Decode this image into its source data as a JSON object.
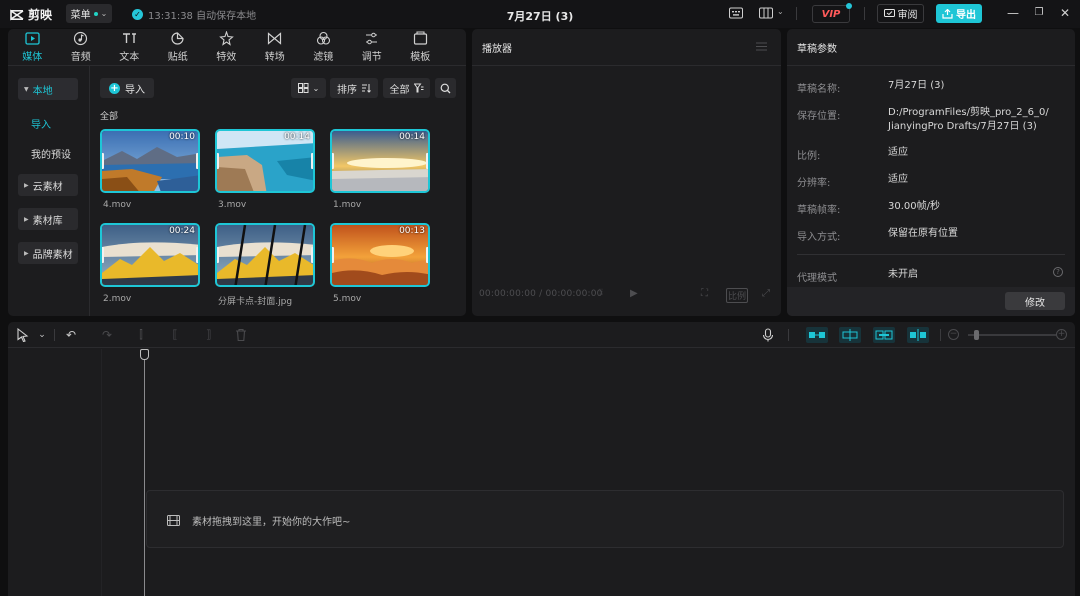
{
  "app": {
    "name": "剪映",
    "menu_label": "菜单",
    "save_status": "13:31:38 自动保存本地",
    "title": "7月27日 (3)",
    "vip_label": "VIP",
    "review_label": "审阅",
    "export_label": "导出",
    "accent_color": "#1ec6d6"
  },
  "media_tabs": [
    {
      "label": "媒体",
      "icon": "media-icon",
      "active": true
    },
    {
      "label": "音频",
      "icon": "audio-icon",
      "active": false
    },
    {
      "label": "文本",
      "icon": "text-icon",
      "active": false
    },
    {
      "label": "贴纸",
      "icon": "sticker-icon",
      "active": false
    },
    {
      "label": "特效",
      "icon": "effects-icon",
      "active": false
    },
    {
      "label": "转场",
      "icon": "transition-icon",
      "active": false
    },
    {
      "label": "滤镜",
      "icon": "filter-icon",
      "active": false
    },
    {
      "label": "调节",
      "icon": "adjust-icon",
      "active": false
    },
    {
      "label": "模板",
      "icon": "template-icon",
      "active": false
    }
  ],
  "sidebar": {
    "local": "本地",
    "import": "导入",
    "my_presets": "我的预设",
    "cloud": "云素材",
    "library": "素材库",
    "brand": "品牌素材"
  },
  "media_toolbar": {
    "import_label": "导入",
    "sort_label": "排序",
    "filter_label": "全部"
  },
  "media_section_label": "全部",
  "media_items": [
    {
      "name": "4.mov",
      "duration": "00:10"
    },
    {
      "name": "3.mov",
      "duration": "00:14"
    },
    {
      "name": "1.mov",
      "duration": "00:14"
    },
    {
      "name": "2.mov",
      "duration": "00:24"
    },
    {
      "name": "分屏卡点-封面.jpg",
      "duration": ""
    },
    {
      "name": "5.mov",
      "duration": "00:13"
    }
  ],
  "player": {
    "title": "播放器",
    "timecode_current": "00:00:00:00",
    "timecode_total": "00:00:00:00",
    "ratio_label": "比例"
  },
  "draft": {
    "title": "草稿参数",
    "rows": [
      {
        "key": "草稿名称:",
        "value": "7月27日 (3)"
      },
      {
        "key": "保存位置:",
        "value": "D:/ProgramFiles/剪映_pro_2_6_0/",
        "value2": "JianyingPro Drafts/7月27日 (3)"
      },
      {
        "key": "比例:",
        "value": "适应"
      },
      {
        "key": "分辨率:",
        "value": "适应"
      },
      {
        "key": "草稿帧率:",
        "value": "30.00帧/秒"
      },
      {
        "key": "导入方式:",
        "value": "保留在原有位置"
      },
      {
        "key": "代理模式",
        "value": "未开启"
      }
    ],
    "modify_label": "修改"
  },
  "timeline": {
    "drop_hint": "素材拖拽到这里，开始你的大作吧~"
  }
}
